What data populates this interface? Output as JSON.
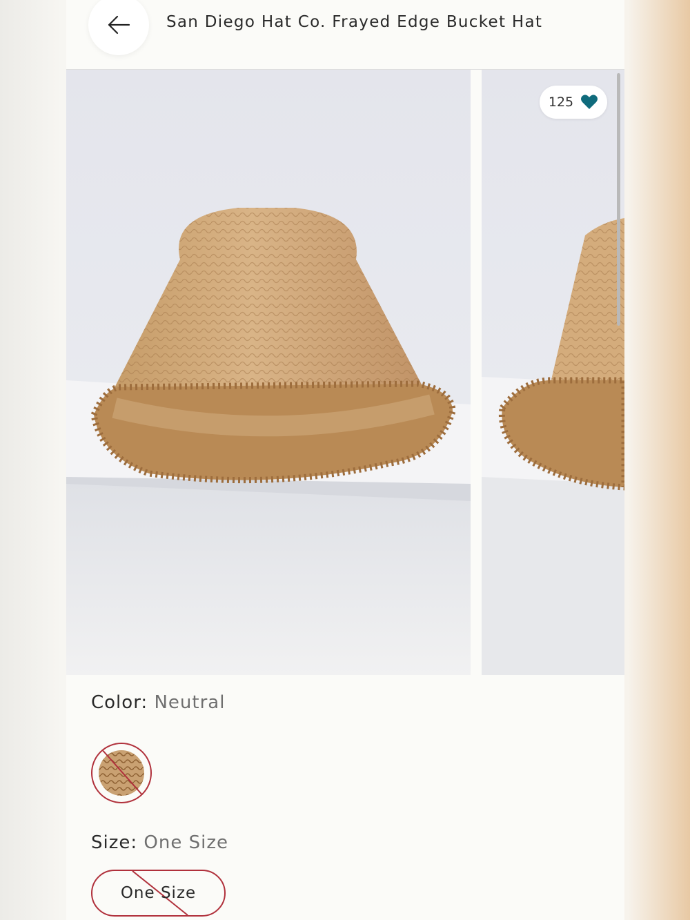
{
  "header": {
    "title": "San Diego Hat Co. Frayed Edge Bucket Hat",
    "back_icon": "arrow-left-icon"
  },
  "gallery": {
    "like_count": "125",
    "like_icon": "heart-icon",
    "like_color": "#0f6b7c"
  },
  "color": {
    "label": "Color:",
    "value": "Neutral"
  },
  "size": {
    "label": "Size:",
    "value": "One Size",
    "option": "One Size"
  },
  "colors": {
    "unavailable": "#b0303b",
    "straw": "#c9a172"
  }
}
